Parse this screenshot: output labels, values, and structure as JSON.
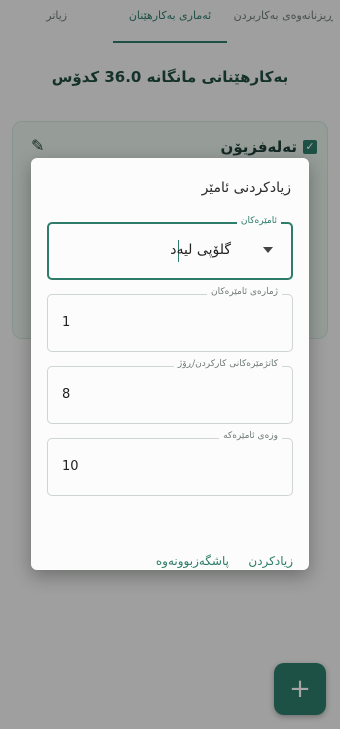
{
  "tabs": [
    {
      "label": "ڕیزنانەوەی بەکاربردن"
    },
    {
      "label": "ئەماری بەکارهێنان"
    },
    {
      "label": "زیاتر"
    }
  ],
  "headline": "بەکارهێنانی مانگانە 36.0 کدۆس",
  "card": {
    "title": "تەلەفزیۆن"
  },
  "dialog": {
    "title": "زیادکردنی ئامێر",
    "device_field": {
      "label": "ئامێرەکان",
      "value": "گلۆپی لیەد"
    },
    "quantity_field": {
      "label": "ژمارەی ئامێرەکان",
      "value": "1"
    },
    "hours_field": {
      "label": "کاتژمێرەکانی کارکردن/ڕۆژ",
      "value": "8"
    },
    "power_field": {
      "label": "وزەی ئامێرەکە",
      "value": "10"
    },
    "add_label": "زیادکردن",
    "cancel_label": "پاشگەزبوونەوە"
  },
  "fab_label": "+",
  "colors": {
    "accent": "#2e7d6a"
  }
}
